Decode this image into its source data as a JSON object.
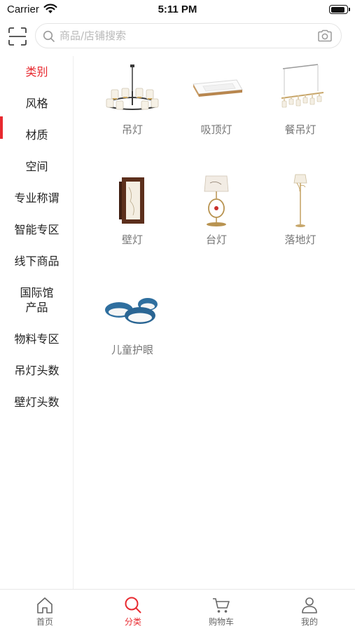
{
  "status_bar": {
    "carrier": "Carrier",
    "time": "5:11 PM",
    "battery_level": 0.95
  },
  "header": {
    "scan_icon": "scan-icon",
    "search_placeholder": "商品/店铺搜索",
    "search_value": "",
    "search_icon": "search-icon",
    "camera_icon": "camera-icon"
  },
  "sidebar": {
    "active_index": 0,
    "items": [
      {
        "label": "类别"
      },
      {
        "label": "风格"
      },
      {
        "label": "材质"
      },
      {
        "label": "空间"
      },
      {
        "label": "专业称谓"
      },
      {
        "label": "智能专区"
      },
      {
        "label": "线下商品"
      },
      {
        "label": "国际馆",
        "label_line2": "产品"
      },
      {
        "label": "物料专区"
      },
      {
        "label": "吊灯头数"
      },
      {
        "label": "壁灯头数"
      }
    ]
  },
  "categories": [
    {
      "label": "吊灯",
      "icon": "chandelier-icon"
    },
    {
      "label": "吸顶灯",
      "icon": "ceiling-light-icon"
    },
    {
      "label": "餐吊灯",
      "icon": "dining-pendant-icon"
    },
    {
      "label": "壁灯",
      "icon": "wall-lamp-icon"
    },
    {
      "label": "台灯",
      "icon": "table-lamp-icon"
    },
    {
      "label": "落地灯",
      "icon": "floor-lamp-icon"
    },
    {
      "label": "儿童护眼",
      "icon": "kids-eye-care-light-icon"
    }
  ],
  "tabbar": {
    "active_index": 1,
    "tabs": [
      {
        "label": "首页",
        "icon": "home-icon"
      },
      {
        "label": "分类",
        "icon": "search-icon"
      },
      {
        "label": "购物车",
        "icon": "cart-icon"
      },
      {
        "label": "我的",
        "icon": "user-icon"
      }
    ]
  },
  "colors": {
    "accent": "#e8292f",
    "text": "#222222",
    "muted": "#777777",
    "border": "#eeeeee"
  }
}
